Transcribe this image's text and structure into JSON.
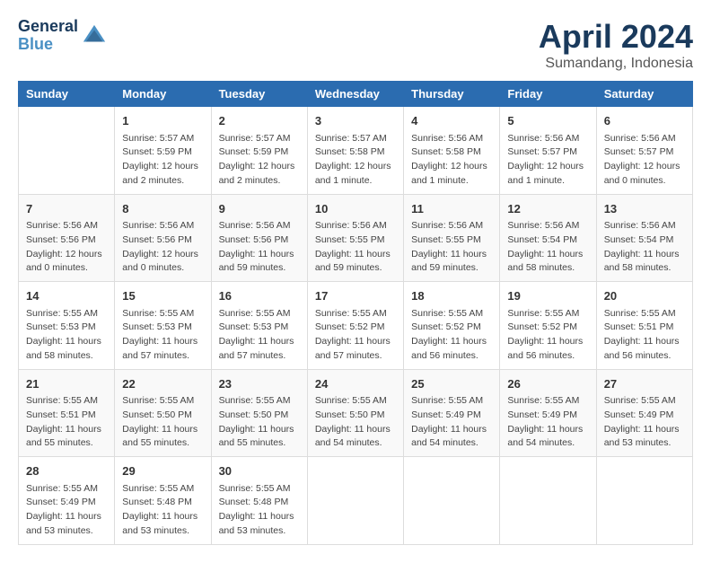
{
  "header": {
    "logo_line1": "General",
    "logo_line2": "Blue",
    "month": "April 2024",
    "location": "Sumandang, Indonesia"
  },
  "columns": [
    "Sunday",
    "Monday",
    "Tuesday",
    "Wednesday",
    "Thursday",
    "Friday",
    "Saturday"
  ],
  "weeks": [
    [
      {
        "day": "",
        "info": ""
      },
      {
        "day": "1",
        "info": "Sunrise: 5:57 AM\nSunset: 5:59 PM\nDaylight: 12 hours\nand 2 minutes."
      },
      {
        "day": "2",
        "info": "Sunrise: 5:57 AM\nSunset: 5:59 PM\nDaylight: 12 hours\nand 2 minutes."
      },
      {
        "day": "3",
        "info": "Sunrise: 5:57 AM\nSunset: 5:58 PM\nDaylight: 12 hours\nand 1 minute."
      },
      {
        "day": "4",
        "info": "Sunrise: 5:56 AM\nSunset: 5:58 PM\nDaylight: 12 hours\nand 1 minute."
      },
      {
        "day": "5",
        "info": "Sunrise: 5:56 AM\nSunset: 5:57 PM\nDaylight: 12 hours\nand 1 minute."
      },
      {
        "day": "6",
        "info": "Sunrise: 5:56 AM\nSunset: 5:57 PM\nDaylight: 12 hours\nand 0 minutes."
      }
    ],
    [
      {
        "day": "7",
        "info": "Sunrise: 5:56 AM\nSunset: 5:56 PM\nDaylight: 12 hours\nand 0 minutes."
      },
      {
        "day": "8",
        "info": "Sunrise: 5:56 AM\nSunset: 5:56 PM\nDaylight: 12 hours\nand 0 minutes."
      },
      {
        "day": "9",
        "info": "Sunrise: 5:56 AM\nSunset: 5:56 PM\nDaylight: 11 hours\nand 59 minutes."
      },
      {
        "day": "10",
        "info": "Sunrise: 5:56 AM\nSunset: 5:55 PM\nDaylight: 11 hours\nand 59 minutes."
      },
      {
        "day": "11",
        "info": "Sunrise: 5:56 AM\nSunset: 5:55 PM\nDaylight: 11 hours\nand 59 minutes."
      },
      {
        "day": "12",
        "info": "Sunrise: 5:56 AM\nSunset: 5:54 PM\nDaylight: 11 hours\nand 58 minutes."
      },
      {
        "day": "13",
        "info": "Sunrise: 5:56 AM\nSunset: 5:54 PM\nDaylight: 11 hours\nand 58 minutes."
      }
    ],
    [
      {
        "day": "14",
        "info": "Sunrise: 5:55 AM\nSunset: 5:53 PM\nDaylight: 11 hours\nand 58 minutes."
      },
      {
        "day": "15",
        "info": "Sunrise: 5:55 AM\nSunset: 5:53 PM\nDaylight: 11 hours\nand 57 minutes."
      },
      {
        "day": "16",
        "info": "Sunrise: 5:55 AM\nSunset: 5:53 PM\nDaylight: 11 hours\nand 57 minutes."
      },
      {
        "day": "17",
        "info": "Sunrise: 5:55 AM\nSunset: 5:52 PM\nDaylight: 11 hours\nand 57 minutes."
      },
      {
        "day": "18",
        "info": "Sunrise: 5:55 AM\nSunset: 5:52 PM\nDaylight: 11 hours\nand 56 minutes."
      },
      {
        "day": "19",
        "info": "Sunrise: 5:55 AM\nSunset: 5:52 PM\nDaylight: 11 hours\nand 56 minutes."
      },
      {
        "day": "20",
        "info": "Sunrise: 5:55 AM\nSunset: 5:51 PM\nDaylight: 11 hours\nand 56 minutes."
      }
    ],
    [
      {
        "day": "21",
        "info": "Sunrise: 5:55 AM\nSunset: 5:51 PM\nDaylight: 11 hours\nand 55 minutes."
      },
      {
        "day": "22",
        "info": "Sunrise: 5:55 AM\nSunset: 5:50 PM\nDaylight: 11 hours\nand 55 minutes."
      },
      {
        "day": "23",
        "info": "Sunrise: 5:55 AM\nSunset: 5:50 PM\nDaylight: 11 hours\nand 55 minutes."
      },
      {
        "day": "24",
        "info": "Sunrise: 5:55 AM\nSunset: 5:50 PM\nDaylight: 11 hours\nand 54 minutes."
      },
      {
        "day": "25",
        "info": "Sunrise: 5:55 AM\nSunset: 5:49 PM\nDaylight: 11 hours\nand 54 minutes."
      },
      {
        "day": "26",
        "info": "Sunrise: 5:55 AM\nSunset: 5:49 PM\nDaylight: 11 hours\nand 54 minutes."
      },
      {
        "day": "27",
        "info": "Sunrise: 5:55 AM\nSunset: 5:49 PM\nDaylight: 11 hours\nand 53 minutes."
      }
    ],
    [
      {
        "day": "28",
        "info": "Sunrise: 5:55 AM\nSunset: 5:49 PM\nDaylight: 11 hours\nand 53 minutes."
      },
      {
        "day": "29",
        "info": "Sunrise: 5:55 AM\nSunset: 5:48 PM\nDaylight: 11 hours\nand 53 minutes."
      },
      {
        "day": "30",
        "info": "Sunrise: 5:55 AM\nSunset: 5:48 PM\nDaylight: 11 hours\nand 53 minutes."
      },
      {
        "day": "",
        "info": ""
      },
      {
        "day": "",
        "info": ""
      },
      {
        "day": "",
        "info": ""
      },
      {
        "day": "",
        "info": ""
      }
    ]
  ]
}
